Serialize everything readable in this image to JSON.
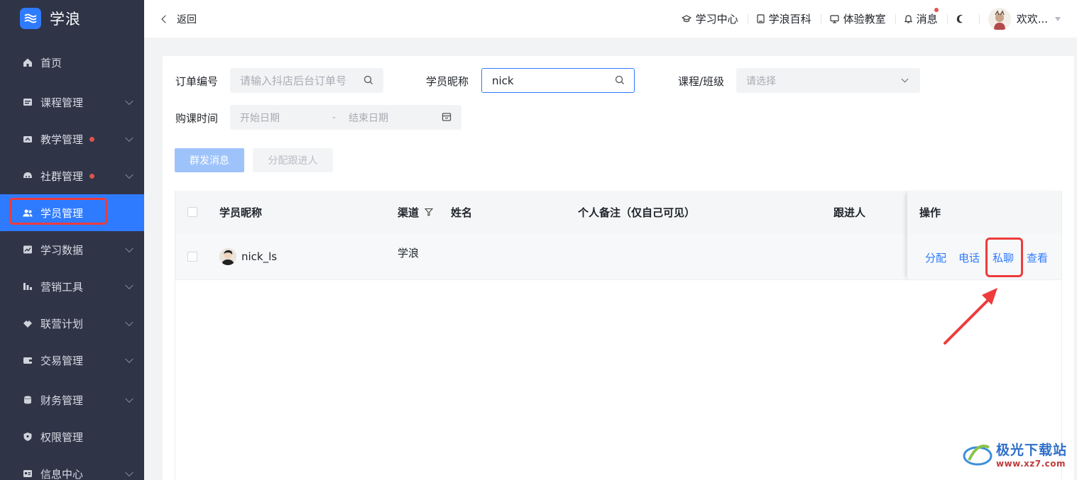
{
  "brand": {
    "name": "学浪"
  },
  "sidebar": {
    "items": [
      {
        "label": "首页",
        "icon": "home-icon",
        "chevron": false,
        "dot": false
      },
      {
        "label": "课程管理",
        "icon": "course-icon",
        "chevron": true,
        "dot": false
      },
      {
        "label": "教学管理",
        "icon": "teaching-icon",
        "chevron": true,
        "dot": true
      },
      {
        "label": "社群管理",
        "icon": "community-icon",
        "chevron": true,
        "dot": true
      },
      {
        "label": "学员管理",
        "icon": "students-icon",
        "chevron": false,
        "dot": false,
        "active": true
      },
      {
        "label": "学习数据",
        "icon": "chart-icon",
        "chevron": true,
        "dot": false
      },
      {
        "label": "营销工具",
        "icon": "marketing-icon",
        "chevron": true,
        "dot": false
      },
      {
        "label": "联营计划",
        "icon": "handshake-icon",
        "chevron": true,
        "dot": false
      },
      {
        "label": "交易管理",
        "icon": "wallet-icon",
        "chevron": true,
        "dot": false
      },
      {
        "label": "财务管理",
        "icon": "finance-icon",
        "chevron": true,
        "dot": false
      },
      {
        "label": "权限管理",
        "icon": "shield-icon",
        "chevron": false,
        "dot": false
      },
      {
        "label": "信息中心",
        "icon": "info-icon",
        "chevron": true,
        "dot": false
      }
    ]
  },
  "topbar": {
    "back_label": "返回",
    "links": [
      {
        "label": "学习中心",
        "icon": "graduation-cap-icon"
      },
      {
        "label": "学浪百科",
        "icon": "book-icon"
      },
      {
        "label": "体验教室",
        "icon": "monitor-icon"
      },
      {
        "label": "消息",
        "icon": "bell-icon"
      }
    ],
    "user_name": "欢欢..."
  },
  "filters": {
    "order_label": "订单编号",
    "order_placeholder": "请输入抖店后台订单号",
    "nickname_label": "学员昵称",
    "nickname_value": "nick",
    "course_label": "课程/班级",
    "course_placeholder": "请选择",
    "time_label": "购课时间",
    "start_placeholder": "开始日期",
    "range_sep": "-",
    "end_placeholder": "结束日期"
  },
  "actions": {
    "broadcast": "群发消息",
    "assign_follower": "分配跟进人"
  },
  "table": {
    "columns": {
      "nickname": "学员昵称",
      "channel": "渠道",
      "name": "姓名",
      "note": "个人备注（仅自己可见）",
      "follower": "跟进人",
      "ops": "操作"
    },
    "rows": [
      {
        "nickname": "nick_ls",
        "channel": "学浪",
        "name": "",
        "note": "",
        "follower": ""
      }
    ],
    "row_ops": {
      "assign": "分配",
      "phone": "电话",
      "chat": "私聊",
      "view": "查看"
    }
  },
  "watermark": {
    "title": "极光下载站",
    "url": "www.xz7.com"
  },
  "colors": {
    "sidebar_bg": "#2f3447",
    "accent": "#2f7bff",
    "highlight": "#ee3b3b"
  }
}
